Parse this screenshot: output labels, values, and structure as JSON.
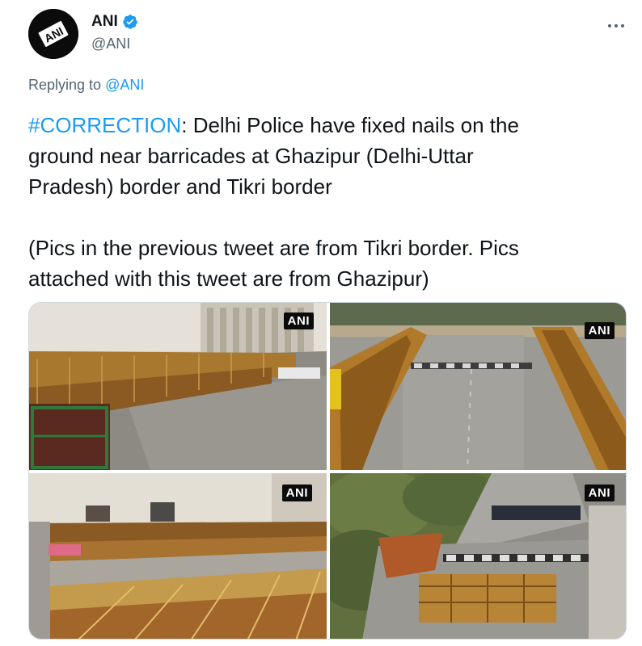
{
  "author": {
    "display_name": "ANI",
    "handle": "@ANI",
    "avatar_logo_text": "ANI",
    "verified": true
  },
  "reply": {
    "prefix": "Replying to",
    "mention": "@ANI"
  },
  "tweet": {
    "hashtag": "#CORRECTION",
    "line1_rest": ": Delhi Police have fixed nails on the",
    "line2": "ground near barricades at Ghazipur (Delhi-Uttar",
    "line3": "Pradesh) border and Tikri border",
    "line4": "(Pics in the previous tweet are from Tikri border. Pics",
    "line5": "attached with this tweet are from Ghazipur)"
  },
  "media": {
    "watermarks": [
      "ANI",
      "ANI",
      "ANI",
      "ANI"
    ]
  },
  "colors": {
    "link": "#1d9bf0",
    "secondary_text": "#536471",
    "primary_text": "#0f1419",
    "verified_badge": "#1d9bf0"
  },
  "icons": {
    "verified": "verified-badge-icon",
    "more": "more-options-icon"
  }
}
